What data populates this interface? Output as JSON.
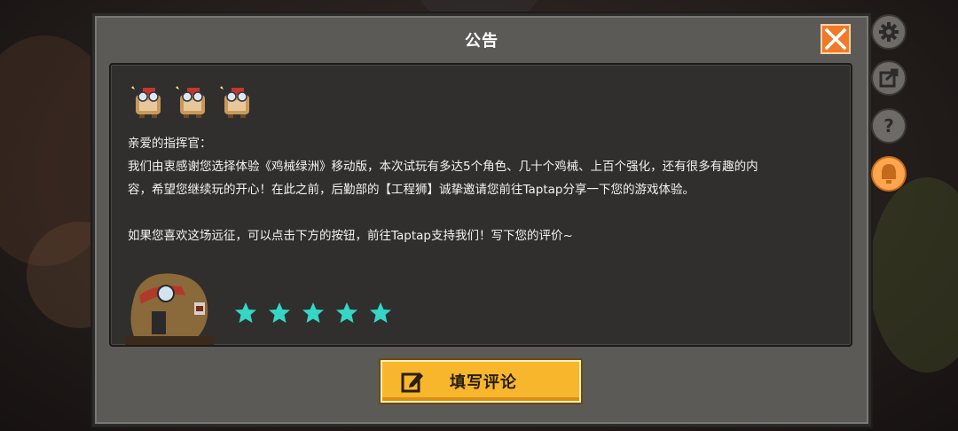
{
  "dialog": {
    "title": "公告"
  },
  "letter": {
    "greeting": "亲爱的指挥官：",
    "line1": "我们由衷感谢您选择体验《鸡械绿洲》移动版，本次试玩有多达5个角色、几十个鸡械、上百个强化，还有很多有趣的内",
    "line2": "容，希望您继续玩的开心！在此之前，后勤部的【工程狮】诚挚邀请您前往Taptap分享一下您的游戏体验。",
    "line3": "如果您喜欢这场远征，可以点击下方的按钮，前往Taptap支持我们！写下您的评价~"
  },
  "rating": {
    "stars": 5,
    "star_color": "#35d6c6"
  },
  "review_button": {
    "label": "填写评论"
  },
  "side_buttons": {
    "help_glyph": "?"
  },
  "colors": {
    "accent": "#f7b62c",
    "close": "#f07a2a",
    "panel": "#302f2d",
    "frame": "#5c5a57"
  },
  "icons": [
    "close-icon",
    "mascot-icon",
    "commander-avatar",
    "star-icon",
    "edit-icon",
    "gear-icon",
    "share-icon",
    "help-icon",
    "notice-icon"
  ]
}
